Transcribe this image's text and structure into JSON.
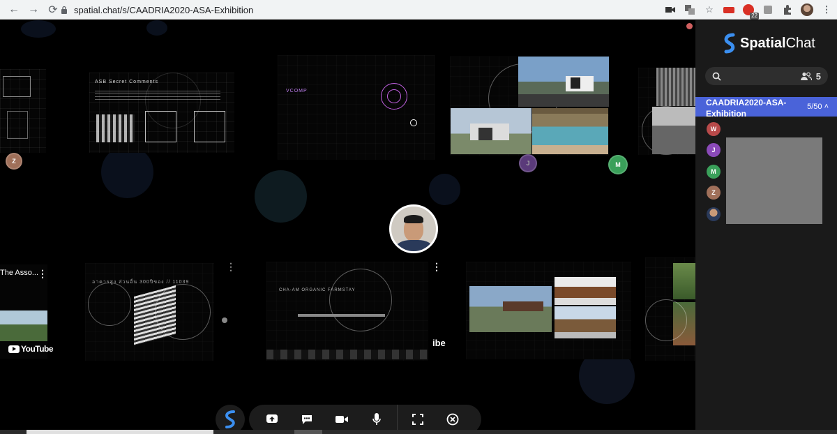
{
  "browser": {
    "url": "spatial.chat/s/CAADRIA2020-ASA-Exhibition",
    "back_icon": "←",
    "forward_icon": "→",
    "reload_icon": "⟳",
    "extension_badge": "22"
  },
  "space": {
    "boards": [
      {
        "title": "ASB Secret Comments"
      },
      {
        "title": "VCOMP"
      },
      {
        "title": "อาคารสูง ส่วนอื่น 300ปีของ // 11039"
      },
      {
        "title": "CHA-AM ORGANIC FARMSTAY"
      }
    ],
    "video_tiles": [
      {
        "label": "The Asso..."
      },
      {
        "label": "YouTube"
      },
      {
        "label": "ibe"
      }
    ],
    "avatars": [
      {
        "initial": "Z",
        "color": "#a0705a"
      },
      {
        "initial": "M",
        "color": "#3aa05a"
      },
      {
        "initial": "J",
        "color": "#5a3a7a"
      }
    ]
  },
  "toolbar": {
    "logo": "S",
    "buttons": [
      "share-screen",
      "chat",
      "camera",
      "microphone",
      "fullscreen",
      "leave"
    ]
  },
  "sidebar": {
    "brand_bold": "Spatial",
    "brand_light": "Chat",
    "participant_count": "5",
    "room_name": "CAADRIA2020-ASA-Exhibition",
    "room_capacity": "5/50",
    "members": [
      {
        "initial": "W",
        "color": "#b84a4a"
      },
      {
        "initial": "J",
        "color": "#8a4ab8"
      },
      {
        "initial": "M",
        "color": "#3aa05a"
      },
      {
        "initial": "Z",
        "color": "#a0705a"
      },
      {
        "initial": "",
        "color": "#c0c0c0"
      }
    ],
    "accent": "#4a63d9"
  }
}
